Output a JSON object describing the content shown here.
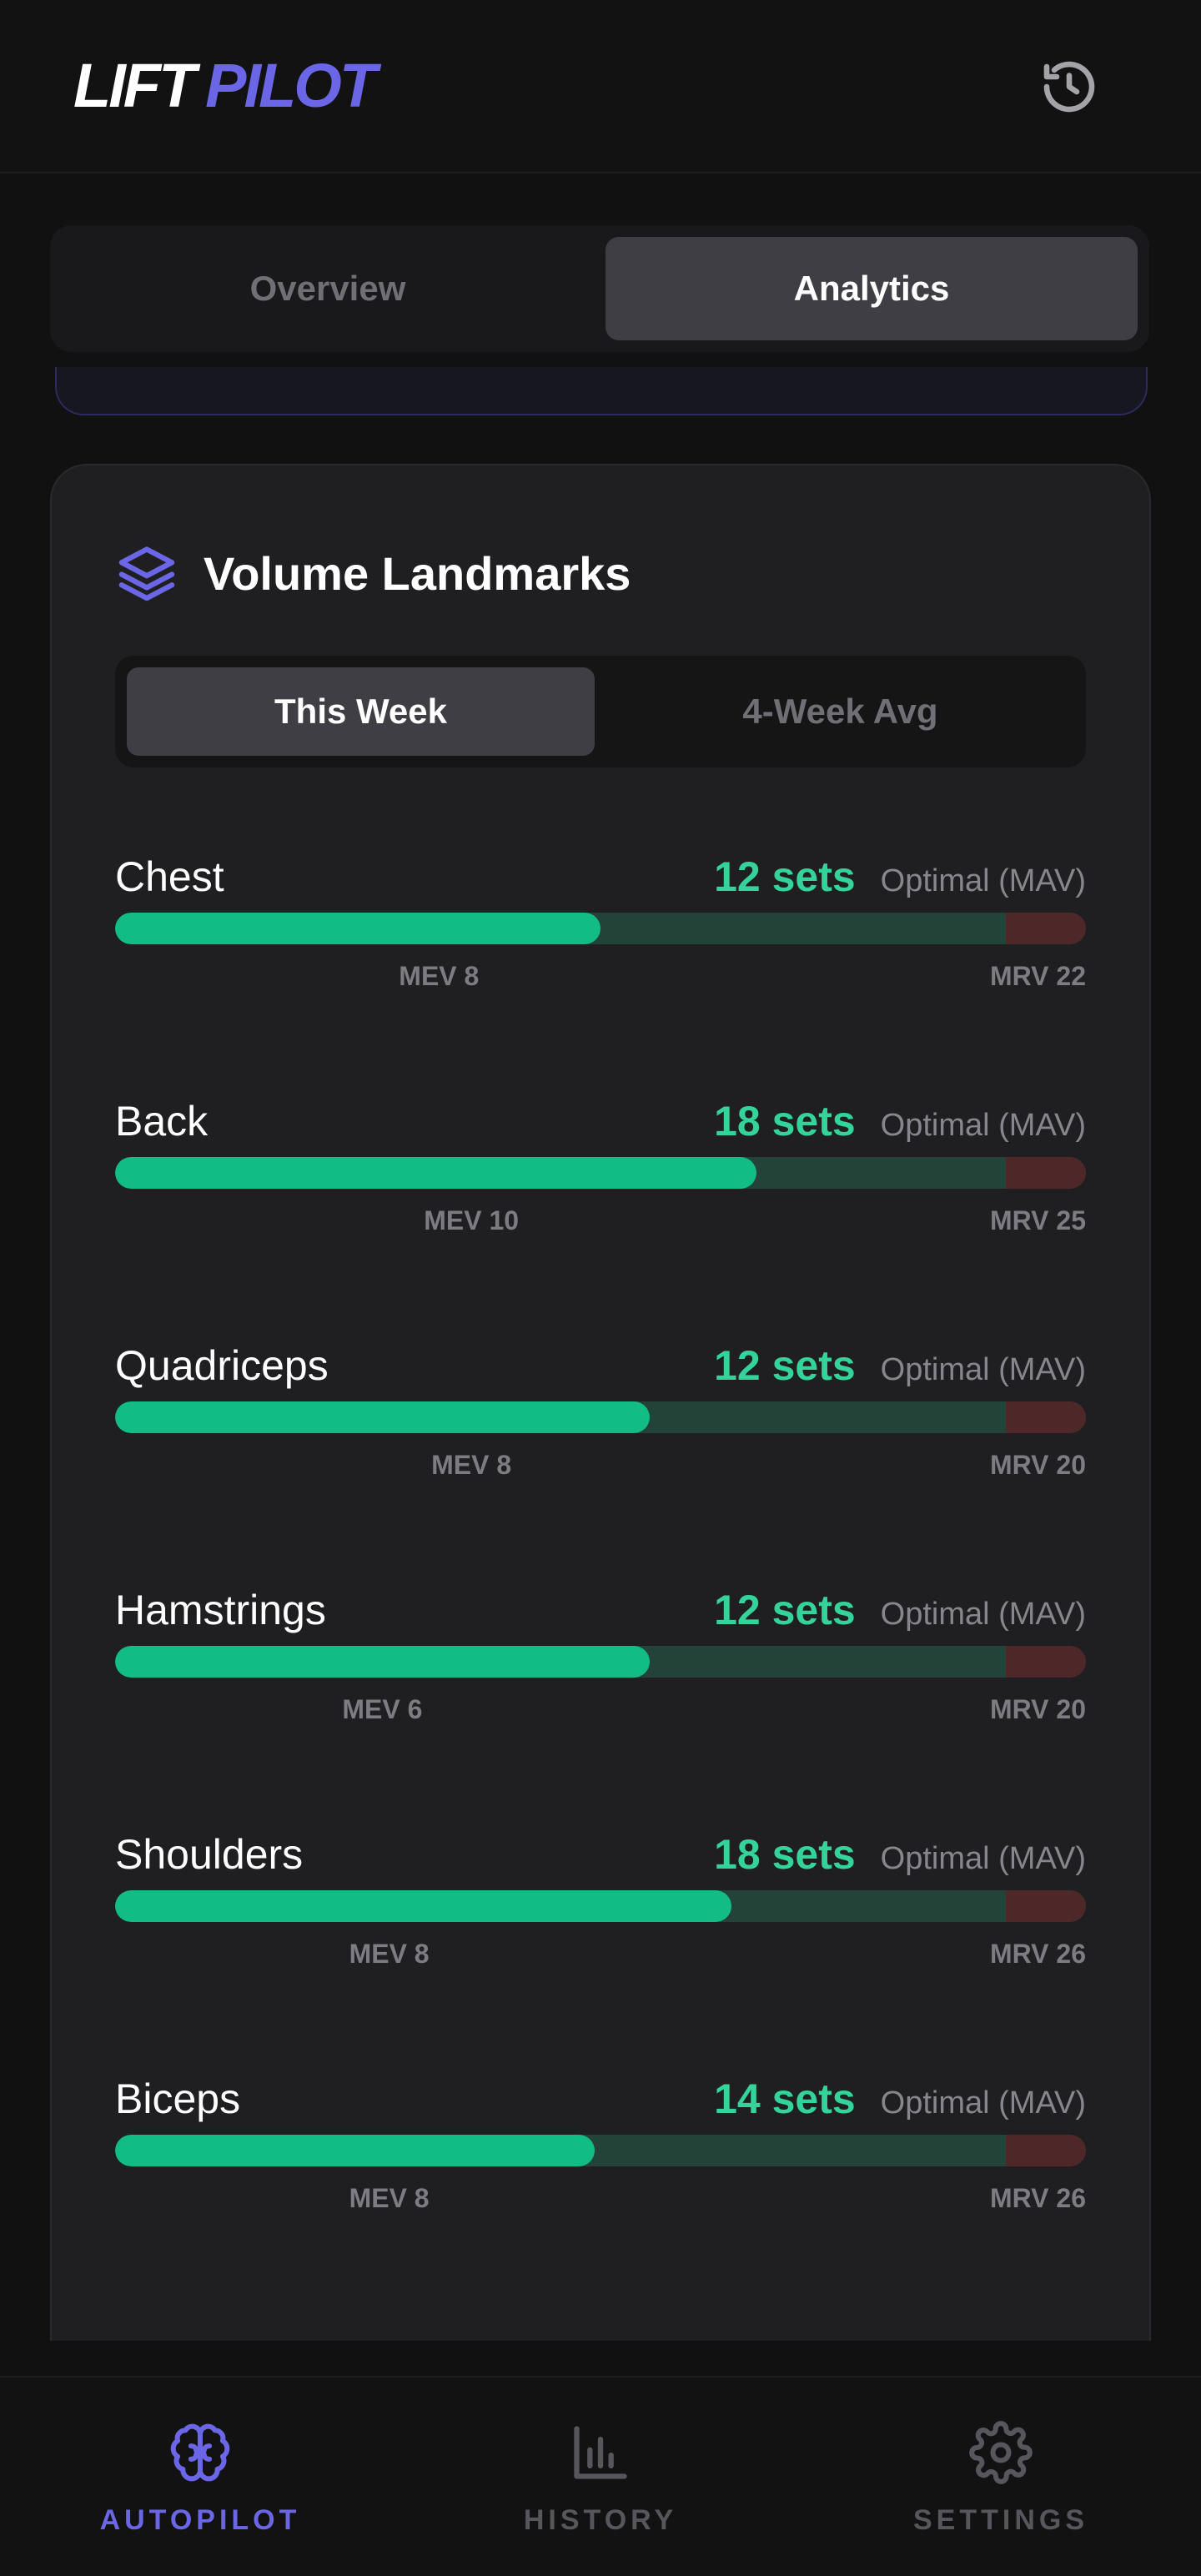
{
  "app": {
    "logo_part1": "LIFT",
    "logo_part2": "PILOT",
    "accent_color": "#6b66e6",
    "history_icon": "history-icon"
  },
  "top_tabs": [
    {
      "label": "Overview",
      "active": false
    },
    {
      "label": "Analytics",
      "active": true
    }
  ],
  "volume_card": {
    "icon": "layers-icon",
    "title": "Volume Landmarks",
    "period_tabs": [
      {
        "label": "This Week",
        "active": true
      },
      {
        "label": "4-Week Avg",
        "active": false
      }
    ],
    "muscles": [
      {
        "name": "Chest",
        "sets": 12,
        "sets_label": "12 sets",
        "zone": "Optimal (MAV)",
        "mev": 8,
        "mev_label": "MEV 8",
        "mrv": 22,
        "mrv_label": "MRV 22"
      },
      {
        "name": "Back",
        "sets": 18,
        "sets_label": "18 sets",
        "zone": "Optimal (MAV)",
        "mev": 10,
        "mev_label": "MEV 10",
        "mrv": 25,
        "mrv_label": "MRV 25"
      },
      {
        "name": "Quadriceps",
        "sets": 12,
        "sets_label": "12 sets",
        "zone": "Optimal (MAV)",
        "mev": 8,
        "mev_label": "MEV 8",
        "mrv": 20,
        "mrv_label": "MRV 20"
      },
      {
        "name": "Hamstrings",
        "sets": 12,
        "sets_label": "12 sets",
        "zone": "Optimal (MAV)",
        "mev": 6,
        "mev_label": "MEV 6",
        "mrv": 20,
        "mrv_label": "MRV 20"
      },
      {
        "name": "Shoulders",
        "sets": 18,
        "sets_label": "18 sets",
        "zone": "Optimal (MAV)",
        "mev": 8,
        "mev_label": "MEV 8",
        "mrv": 26,
        "mrv_label": "MRV 26"
      },
      {
        "name": "Biceps",
        "sets": 14,
        "sets_label": "14 sets",
        "zone": "Optimal (MAV)",
        "mev": 8,
        "mev_label": "MEV 8",
        "mrv": 26,
        "mrv_label": "MRV 26"
      }
    ],
    "bar_colors": {
      "fill": "#11bc85",
      "track": "#234238",
      "over_mrv": "#4e2829",
      "sets_text": "#34d399"
    }
  },
  "bottom_nav": [
    {
      "label": "AUTOPILOT",
      "icon": "brain-icon",
      "active": true
    },
    {
      "label": "HISTORY",
      "icon": "bar-chart-icon",
      "active": false
    },
    {
      "label": "SETTINGS",
      "icon": "gear-icon",
      "active": false
    }
  ]
}
